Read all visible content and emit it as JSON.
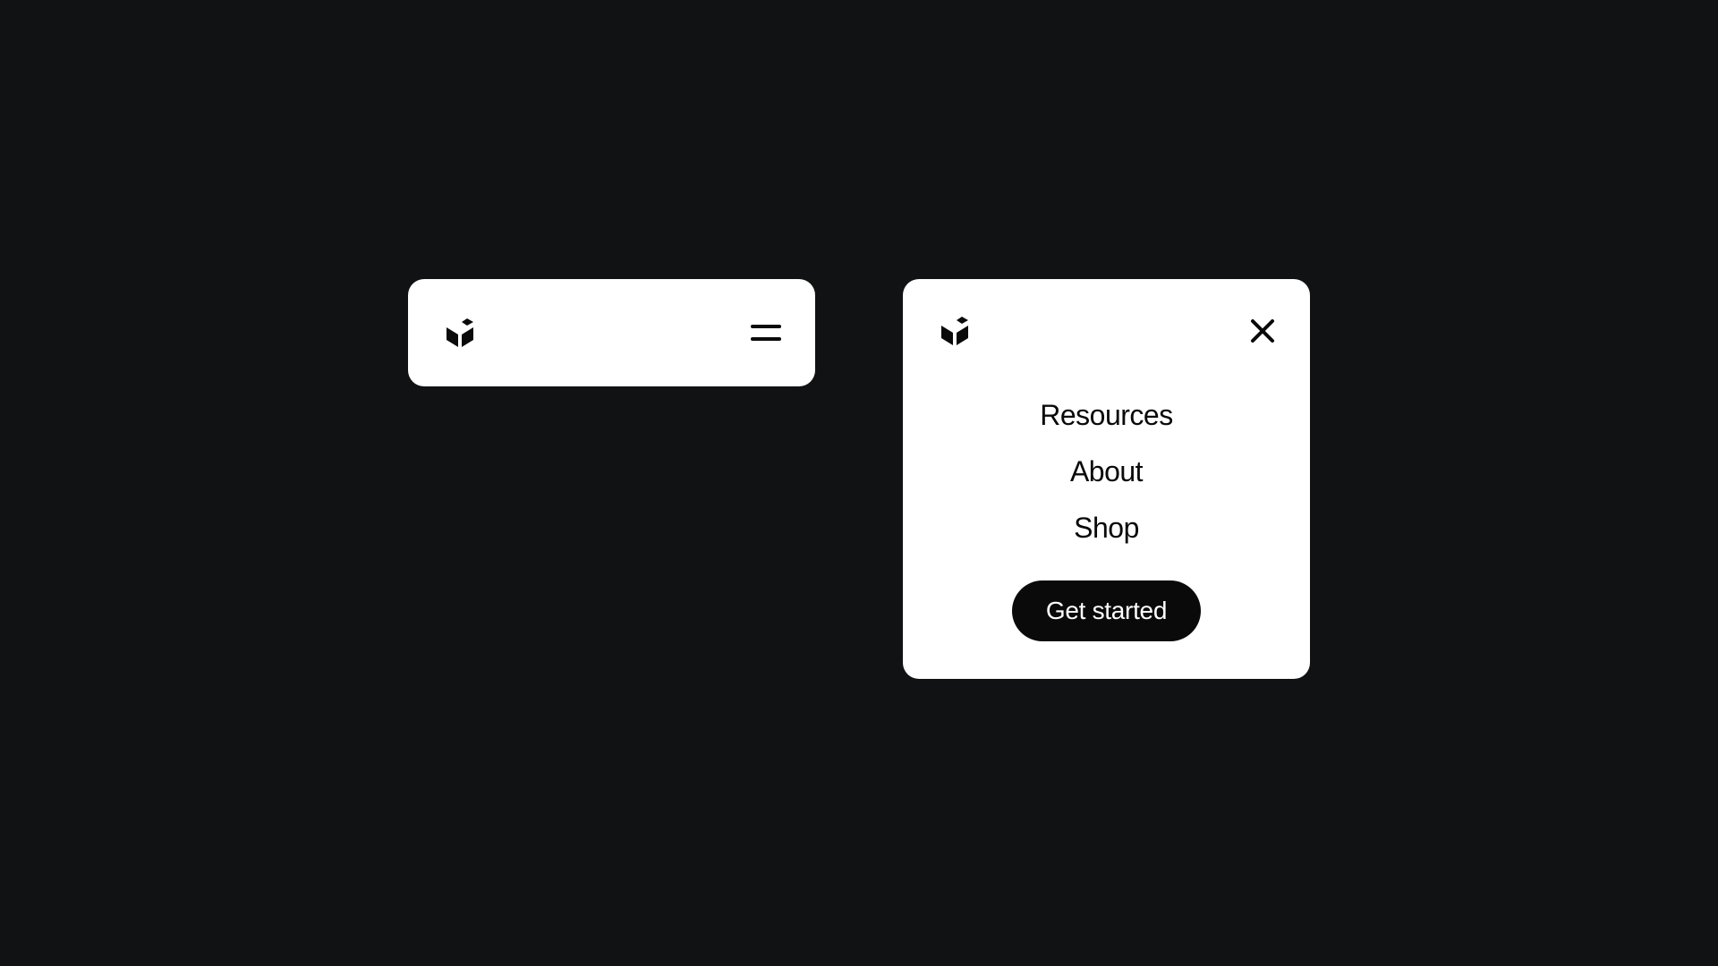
{
  "menu": {
    "items": [
      "Resources",
      "About",
      "Shop"
    ],
    "cta_label": "Get started"
  },
  "icons": {
    "logo": "logo-icon",
    "hamburger": "hamburger-icon",
    "close": "close-icon"
  }
}
